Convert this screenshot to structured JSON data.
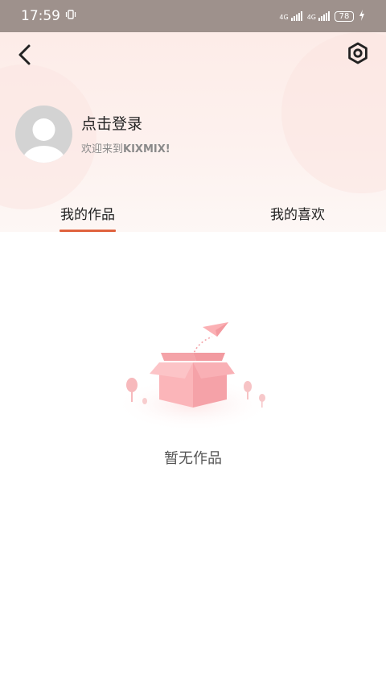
{
  "status_bar": {
    "time": "17:59",
    "network1": "4G",
    "network2": "4G",
    "battery": "78"
  },
  "profile": {
    "login_label": "点击登录",
    "welcome_prefix": "欢迎来到",
    "welcome_brand": "KIXMIX!"
  },
  "tabs": [
    {
      "label": "我的作品",
      "active": true
    },
    {
      "label": "我的喜欢",
      "active": false
    }
  ],
  "empty_state": {
    "text": "暂无作品"
  },
  "colors": {
    "accent": "#e0633f",
    "status_bar": "#9e918c",
    "header_bg": "#fdece8"
  }
}
